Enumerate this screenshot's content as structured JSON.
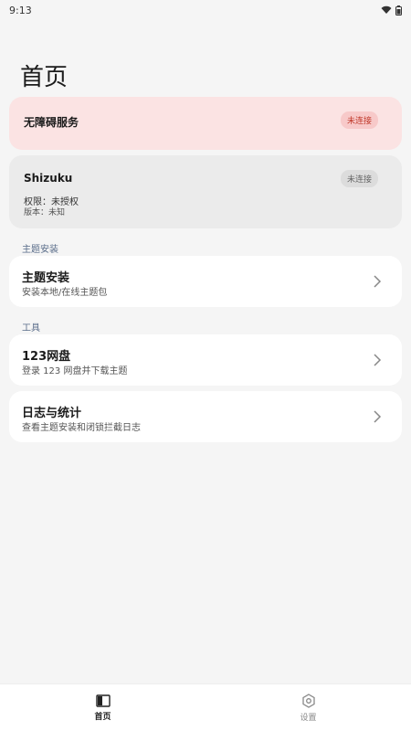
{
  "status_bar": {
    "time": "9:13"
  },
  "page": {
    "title": "首页"
  },
  "accessibility_card": {
    "title": "无障碍服务",
    "status": "未连接"
  },
  "shizuku_card": {
    "title": "Shizuku",
    "status": "未连接",
    "permission": "权限：未授权",
    "version": "版本：未知"
  },
  "sections": [
    {
      "label": "主题安装"
    },
    {
      "label": "工具"
    }
  ],
  "items": [
    {
      "title": "主题安装",
      "subtitle": "安装本地/在线主题包"
    },
    {
      "title": "123网盘",
      "subtitle": "登录 123 网盘并下载主题"
    },
    {
      "title": "日志与统计",
      "subtitle": "查看主题安装和闭锁拦截日志"
    }
  ],
  "bottom_nav": [
    {
      "label": "首页",
      "icon": "book-icon",
      "active": true
    },
    {
      "label": "设置",
      "icon": "gear-icon",
      "active": false
    }
  ],
  "colors": {
    "accent_red": "#c0392b",
    "card_red": "#fbe3e3"
  }
}
